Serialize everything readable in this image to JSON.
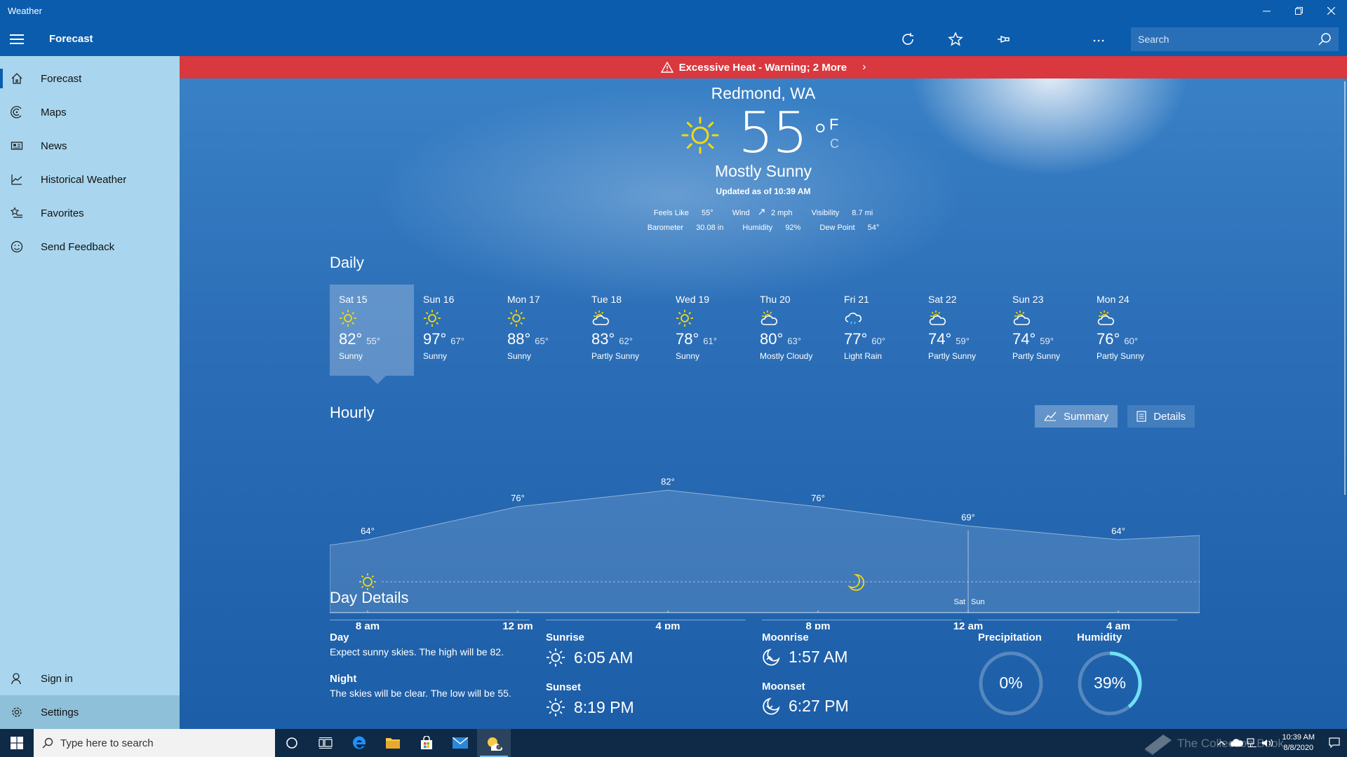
{
  "window": {
    "title": "Weather"
  },
  "header": {
    "title": "Forecast",
    "search_placeholder": "Search"
  },
  "sidebar": {
    "items": [
      {
        "label": "Forecast",
        "icon": "home-icon",
        "active": true
      },
      {
        "label": "Maps",
        "icon": "maps-icon"
      },
      {
        "label": "News",
        "icon": "news-icon"
      },
      {
        "label": "Historical Weather",
        "icon": "chart-icon"
      },
      {
        "label": "Favorites",
        "icon": "favorites-icon"
      },
      {
        "label": "Send Feedback",
        "icon": "smiley-icon"
      }
    ],
    "sign_in": "Sign in",
    "settings": "Settings"
  },
  "alert": {
    "text": "Excessive Heat - Warning; 2 More"
  },
  "current": {
    "location": "Redmond, WA",
    "temp": "55",
    "degree": "°",
    "unit_f": "F",
    "unit_c": "C",
    "condition": "Mostly Sunny",
    "updated": "Updated as of 10:39 AM",
    "feels_like_label": "Feels Like",
    "feels_like": "55°",
    "wind_label": "Wind",
    "wind": "2 mph",
    "visibility_label": "Visibility",
    "visibility": "8.7 mi",
    "barometer_label": "Barometer",
    "barometer": "30.08 in",
    "humidity_label": "Humidity",
    "humidity": "92%",
    "dewpoint_label": "Dew Point",
    "dewpoint": "54°"
  },
  "daily": {
    "title": "Daily",
    "days": [
      {
        "name": "Sat 15",
        "hi": "82°",
        "lo": "55°",
        "cond": "Sunny",
        "icon": "sun"
      },
      {
        "name": "Sun 16",
        "hi": "97°",
        "lo": "67°",
        "cond": "Sunny",
        "icon": "sun"
      },
      {
        "name": "Mon 17",
        "hi": "88°",
        "lo": "65°",
        "cond": "Sunny",
        "icon": "sun"
      },
      {
        "name": "Tue 18",
        "hi": "83°",
        "lo": "62°",
        "cond": "Partly Sunny",
        "icon": "partly"
      },
      {
        "name": "Wed 19",
        "hi": "78°",
        "lo": "61°",
        "cond": "Sunny",
        "icon": "sun"
      },
      {
        "name": "Thu 20",
        "hi": "80°",
        "lo": "63°",
        "cond": "Mostly Cloudy",
        "icon": "partly"
      },
      {
        "name": "Fri 21",
        "hi": "77°",
        "lo": "60°",
        "cond": "Light Rain",
        "icon": "rain"
      },
      {
        "name": "Sat 22",
        "hi": "74°",
        "lo": "59°",
        "cond": "Partly Sunny",
        "icon": "partly"
      },
      {
        "name": "Sun 23",
        "hi": "74°",
        "lo": "59°",
        "cond": "Partly Sunny",
        "icon": "partly"
      },
      {
        "name": "Mon 24",
        "hi": "76°",
        "lo": "60°",
        "cond": "Partly Sunny",
        "icon": "partly"
      }
    ]
  },
  "hourly": {
    "title": "Hourly",
    "summary_label": "Summary",
    "details_label": "Details",
    "day_split": [
      "Sat",
      "Sun"
    ]
  },
  "chart_data": {
    "type": "area",
    "x": [
      "8 am",
      "12 pm",
      "4 pm",
      "8 pm",
      "12 am",
      "4 am"
    ],
    "values": [
      64,
      76,
      82,
      76,
      69,
      64
    ],
    "labels": [
      "64°",
      "76°",
      "82°",
      "76°",
      "69°",
      "64°"
    ],
    "ylim": [
      40,
      90
    ],
    "grid": false
  },
  "day_details": {
    "title": "Day Details",
    "day_label": "Day",
    "day_text": "Expect sunny skies. The high will be 82.",
    "night_label": "Night",
    "night_text": "The skies will be clear. The low will be 55.",
    "sunrise_label": "Sunrise",
    "sunrise": "6:05 AM",
    "sunset_label": "Sunset",
    "sunset": "8:19 PM",
    "moonrise_label": "Moonrise",
    "moonrise": "1:57 AM",
    "moonset_label": "Moonset",
    "moonset": "6:27 PM",
    "precip_label": "Precipitation",
    "precip": "0%",
    "precip_fraction": 0,
    "humidity_label": "Humidity",
    "humidity": "39%",
    "humidity_fraction": 0.39
  },
  "taskbar": {
    "search_placeholder": "Type here to search",
    "time": "10:39 AM",
    "date": "8/8/2020",
    "watermark": "The Collection Book"
  },
  "colors": {
    "accent": "#0b5cad",
    "alert": "#d8383e",
    "sidebar": "#a9d6ee",
    "sun": "#f5d90a",
    "ring": "#6fe0f5"
  }
}
